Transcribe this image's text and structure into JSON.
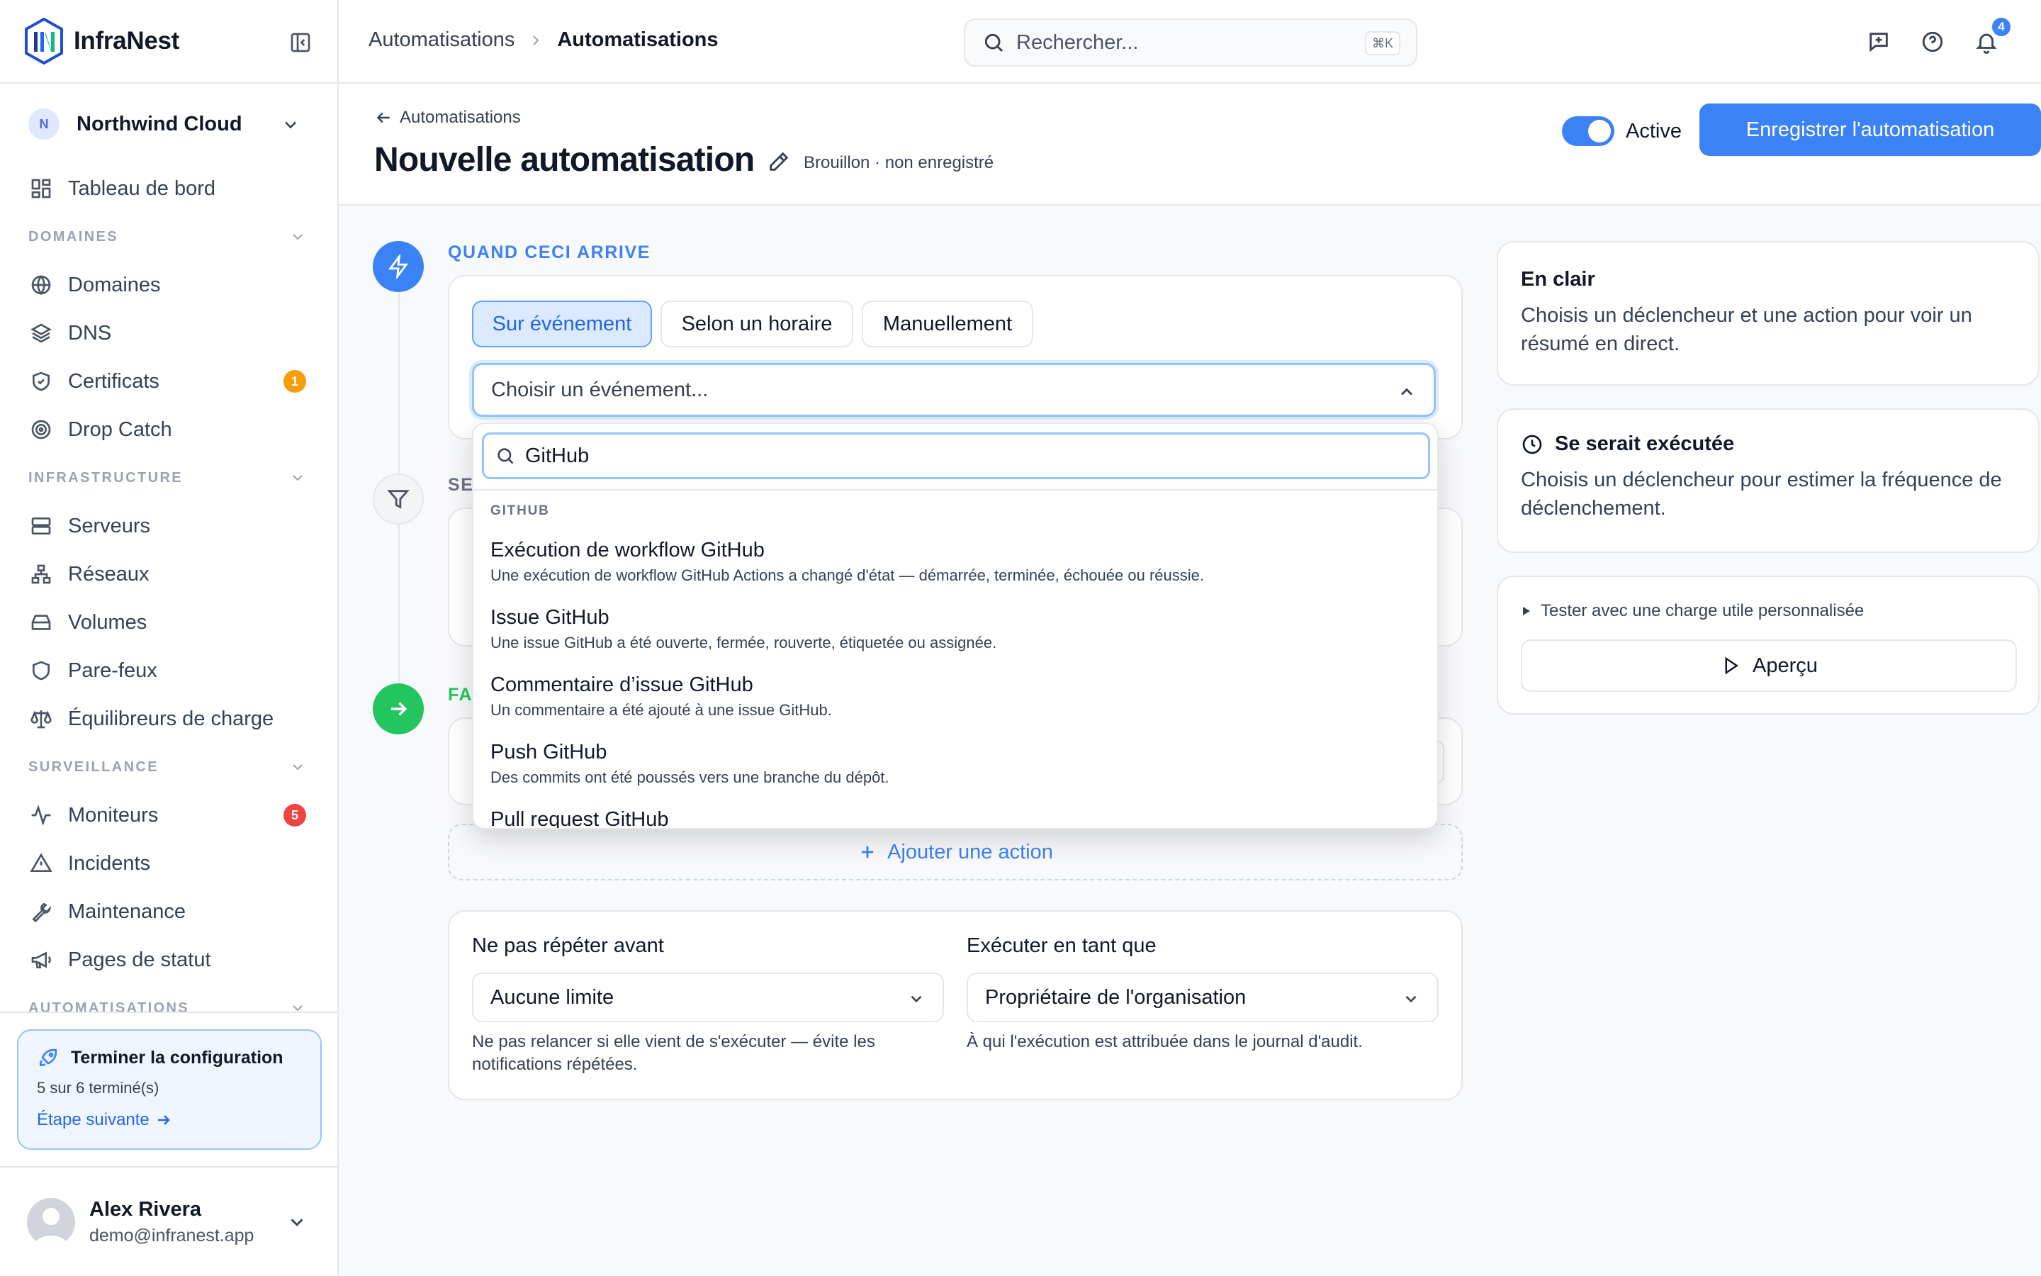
{
  "brand": {
    "name": "InfraNest"
  },
  "workspace": {
    "initial": "N",
    "name": "Northwind Cloud"
  },
  "nav": {
    "dashboard": "Tableau de bord",
    "sections": {
      "domains": "DOMAINES",
      "infrastructure": "INFRASTRUCTURE",
      "monitoring": "SURVEILLANCE",
      "automations": "AUTOMATISATIONS"
    },
    "items": {
      "domains": "Domaines",
      "dns": "DNS",
      "certificates": "Certificats",
      "drop_catch": "Drop Catch",
      "servers": "Serveurs",
      "networks": "Réseaux",
      "volumes": "Volumes",
      "firewalls": "Pare-feux",
      "load_balancers": "Équilibreurs de charge",
      "monitors": "Moniteurs",
      "incidents": "Incidents",
      "maintenance": "Maintenance",
      "status_pages": "Pages de statut"
    },
    "badges": {
      "certificates": "1",
      "monitors": "5"
    }
  },
  "setup": {
    "title": "Terminer la configuration",
    "progress": "5 sur 6 terminé(s)",
    "next": "Étape suivante"
  },
  "user": {
    "name": "Alex Rivera",
    "email": "demo@infranest.app"
  },
  "topbar": {
    "crumb_parent": "Automatisations",
    "crumb_current": "Automatisations",
    "search_placeholder": "Rechercher...",
    "search_shortcut": "⌘K",
    "notification_count": "4"
  },
  "header": {
    "back_label": "Automatisations",
    "title": "Nouvelle automatisation",
    "status": "Brouillon · non enregistré",
    "toggle_label": "Active",
    "save_label": "Enregistrer l'automatisation"
  },
  "trigger": {
    "step_label": "QUAND CECI ARRIVE",
    "modes": [
      "Sur événement",
      "Selon un horaire",
      "Manuellement"
    ],
    "select_placeholder": "Choisir un événement..."
  },
  "condition": {
    "step_label_fragment": "SE"
  },
  "action": {
    "step_label_fragment": "FA",
    "add_label": "Ajouter une action"
  },
  "dropdown": {
    "search_value": "GitHub",
    "group": "GITHUB",
    "options": [
      {
        "title": "Exécution de workflow GitHub",
        "desc": "Une exécution de workflow GitHub Actions a changé d'état — démarrée, terminée, échouée ou réussie."
      },
      {
        "title": "Issue GitHub",
        "desc": "Une issue GitHub a été ouverte, fermée, rouverte, étiquetée ou assignée."
      },
      {
        "title": "Commentaire d’issue GitHub",
        "desc": "Un commentaire a été ajouté à une issue GitHub."
      },
      {
        "title": "Push GitHub",
        "desc": "Des commits ont été poussés vers une branche du dépôt."
      },
      {
        "title": "Pull request GitHub",
        "desc": ""
      }
    ]
  },
  "settings": {
    "no_repeat_label": "Ne pas répéter avant",
    "no_repeat_value": "Aucune limite",
    "no_repeat_help": "Ne pas relancer si elle vient de s'exécuter — évite les notifications répétées.",
    "run_as_label": "Exécuter en tant que",
    "run_as_value": "Propriétaire de l'organisation",
    "run_as_help": "À qui l'exécution est attribuée dans le journal d'audit."
  },
  "right_panel": {
    "summary_title": "En clair",
    "summary_text": "Choisis un déclencheur et une action pour voir un résumé en direct.",
    "frequency_title": "Se serait exécutée",
    "frequency_text": "Choisis un déclencheur pour estimer la fréquence de déclenchement.",
    "test_label": "Tester avec une charge utile personnalisée",
    "preview_label": "Aperçu"
  },
  "colors": {
    "accent": "#3b82f6",
    "success": "#22c55e",
    "warning": "#f59e0b",
    "danger": "#ef4444"
  }
}
